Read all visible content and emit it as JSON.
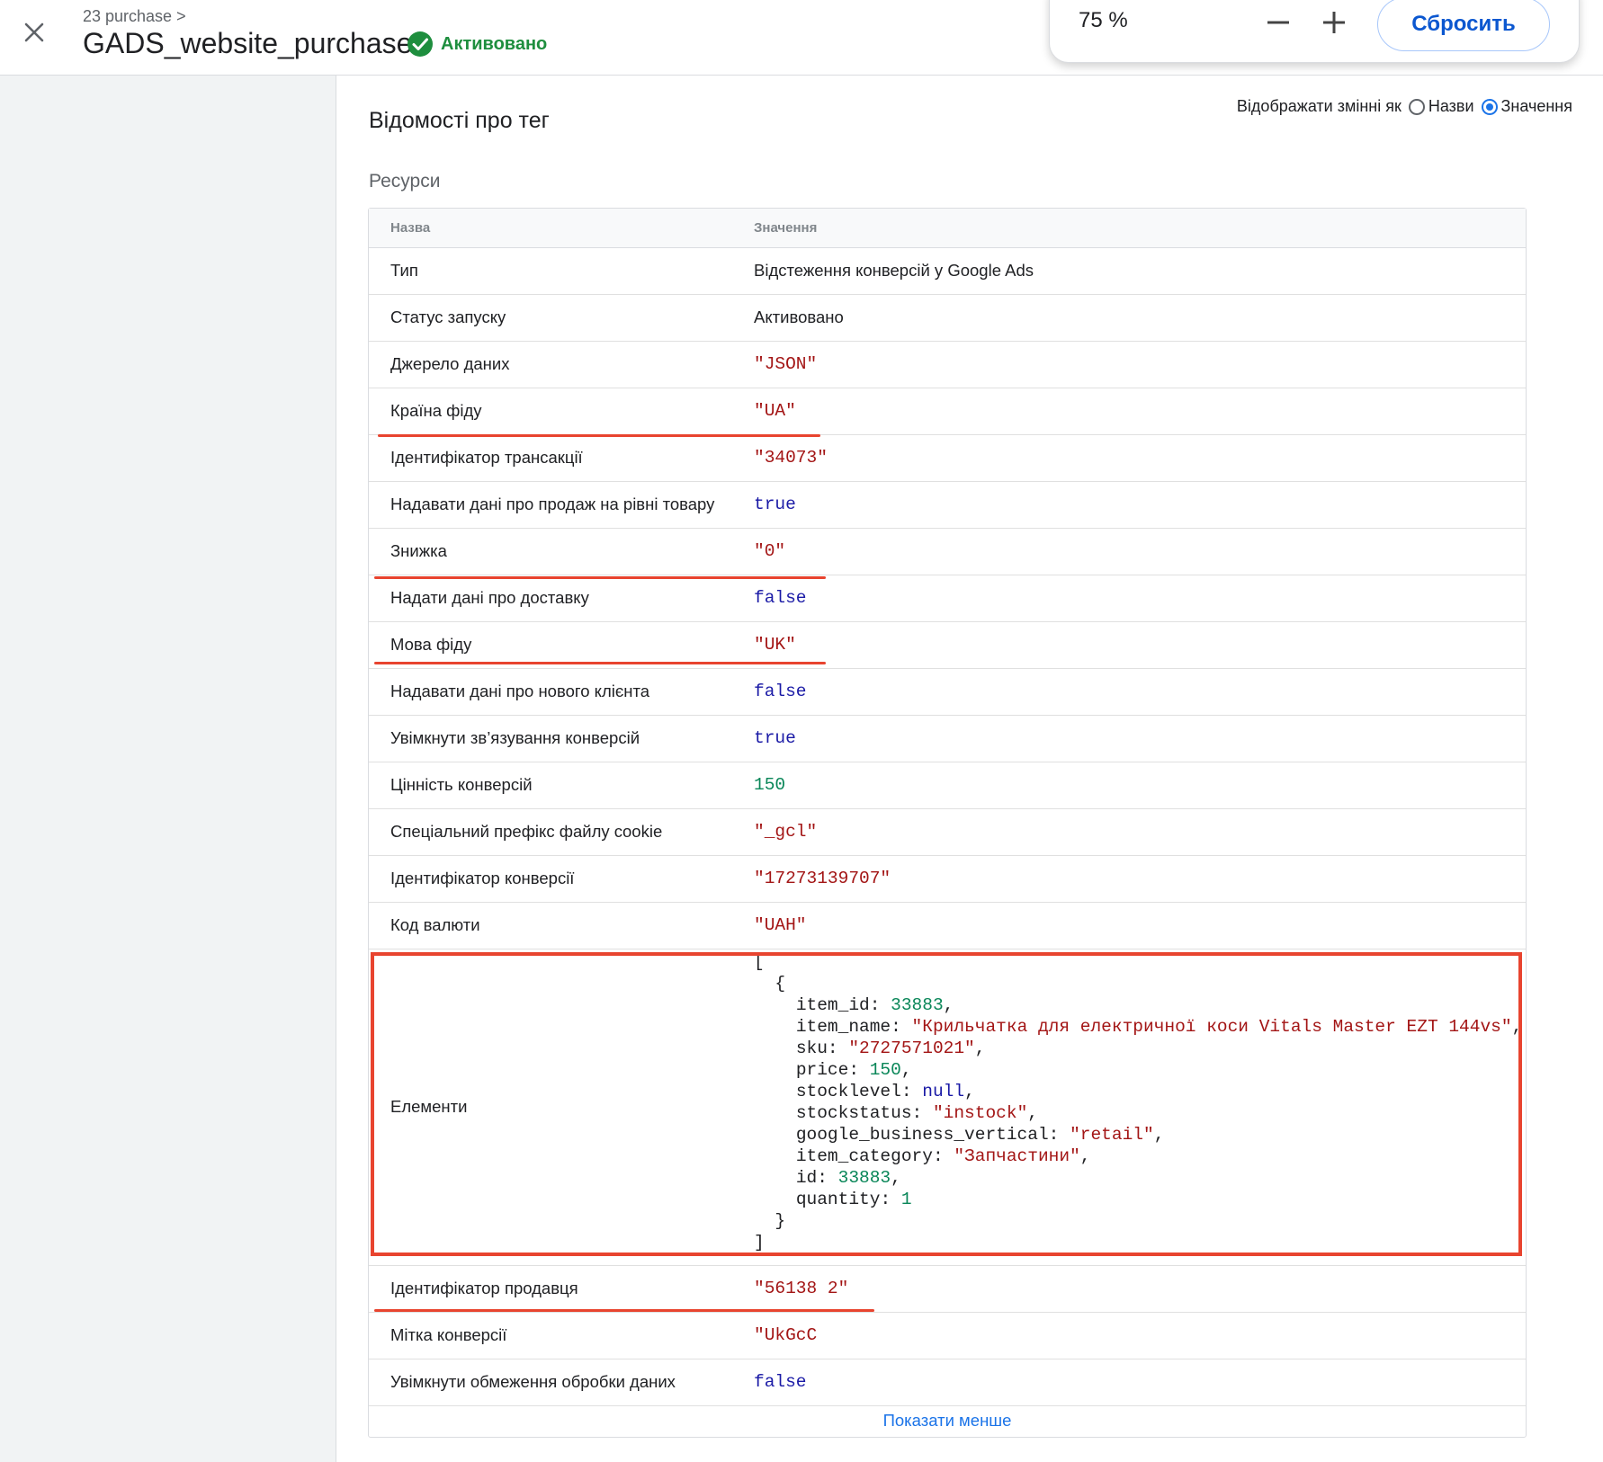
{
  "header": {
    "breadcrumb": "23 purchase >",
    "title": "GADS_website_purchase",
    "status": "Активовано",
    "status_color": "#1e8e3e"
  },
  "zoom": {
    "level": "75 %",
    "reset_label": "Сбросить"
  },
  "panel": {
    "title": "Відомості про тег",
    "display_label": "Відображати змінні як",
    "option_names": "Назви",
    "option_values": "Значення",
    "selected_option": "Значення",
    "section": "Ресурси"
  },
  "table": {
    "col_name": "Назва",
    "col_value": "Значення",
    "rows": [
      {
        "name": "Тип",
        "value": "Відстеження конверсій у Google Ads"
      },
      {
        "name": "Статус запуску",
        "value": "Активовано"
      },
      {
        "name": "Джерело даних",
        "value": "\"JSON\""
      },
      {
        "name": "Країна фіду",
        "value": "\"UA\""
      },
      {
        "name": "Ідентифікатор трансакції",
        "value": "\"34073\""
      },
      {
        "name": "Надавати дані про продаж на рівні товару",
        "value": "true"
      },
      {
        "name": "Знижка",
        "value": "\"0\""
      },
      {
        "name": "Надати дані про доставку",
        "value": "false"
      },
      {
        "name": "Мова фіду",
        "value": "\"UK\""
      },
      {
        "name": "Надавати дані про нового клієнта",
        "value": "false"
      },
      {
        "name": "Увімкнути зв’язування конверсій",
        "value": "true"
      },
      {
        "name": "Цінність конверсій",
        "value": "150"
      },
      {
        "name": "Спеціальний префікс файлу cookie",
        "value": "\"_gcl\""
      },
      {
        "name": "Ідентифікатор конверсії",
        "value": "\"17273139707\""
      },
      {
        "name": "Код валюти",
        "value": "\"UAH\""
      }
    ],
    "elements": {
      "name": "Елементи",
      "open_bracket": "[",
      "open_brace": "{",
      "fields": [
        {
          "key": "item_id",
          "value": "33883"
        },
        {
          "key": "item_name",
          "value": "\"Крильчатка для електричної коси Vitals Master EZT 144vs\""
        },
        {
          "key": "sku",
          "value": "\"2727571021\""
        },
        {
          "key": "price",
          "value": "150"
        },
        {
          "key": "stocklevel",
          "value": "null"
        },
        {
          "key": "stockstatus",
          "value": "\"instock\""
        },
        {
          "key": "google_business_vertical",
          "value": "\"retail\""
        },
        {
          "key": "item_category",
          "value": "\"Запчастини\""
        },
        {
          "key": "id",
          "value": "33883"
        },
        {
          "key": "quantity",
          "value": "1"
        }
      ],
      "close_brace": "}",
      "close_bracket": "]"
    },
    "rows_after": [
      {
        "name": "Ідентифікатор продавця",
        "value": "\"56138     2\""
      },
      {
        "name": "Мітка конверсії",
        "value": "\"UkGcC"
      },
      {
        "name": "Увімкнути обмеження обробки даних",
        "value": "false"
      }
    ],
    "show_less": "Показати менше"
  },
  "annotation_color": "#e8442f"
}
